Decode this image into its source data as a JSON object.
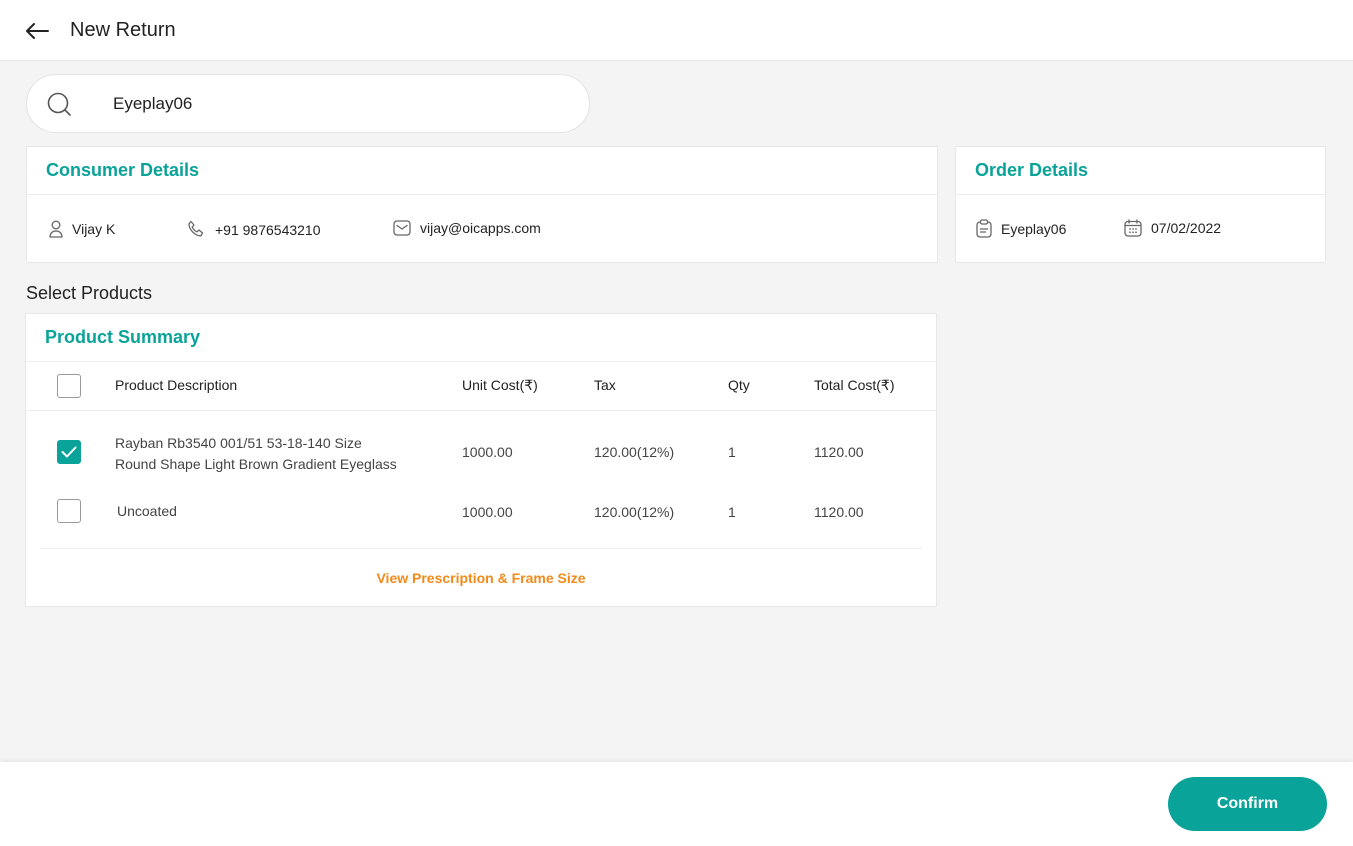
{
  "header": {
    "title": "New Return"
  },
  "search": {
    "value": "Eyeplay06",
    "icon": "search-icon"
  },
  "consumer": {
    "title": "Consumer Details",
    "name": "Vijay K",
    "phone": "+91 9876543210",
    "email": "vijay@oicapps.com"
  },
  "order": {
    "title": "Order Details",
    "id": "Eyeplay06",
    "date": "07/02/2022"
  },
  "select_label": "Select Products",
  "products": {
    "title": "Product Summary",
    "columns": [
      "Product Description",
      "Unit Cost(₹)",
      "Tax",
      "Qty",
      "Total Cost(₹)"
    ],
    "rows": [
      {
        "checked": true,
        "desc_line1": "Rayban Rb3540 001/51 53-18-140 Size",
        "desc_line2": "Round Shape Light Brown Gradient Eyeglass",
        "unit": "1000.00",
        "tax": "120.00(12%)",
        "qty": "1",
        "total": "1120.00"
      },
      {
        "checked": false,
        "desc_line1": "Uncoated",
        "desc_line2": "",
        "unit": "1000.00",
        "tax": "120.00(12%)",
        "qty": "1",
        "total": "1120.00"
      }
    ],
    "link": "View Prescription & Frame Size"
  },
  "footer": {
    "confirm": "Confirm"
  },
  "colors": {
    "accent": "#0aa39a",
    "link": "#f28a1a"
  }
}
